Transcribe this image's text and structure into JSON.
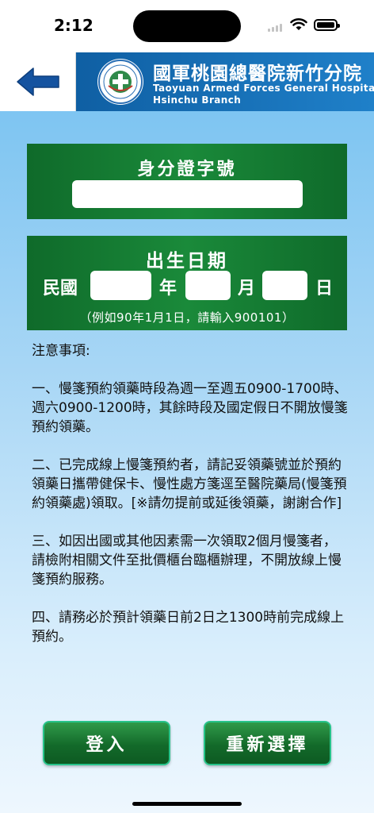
{
  "status_bar": {
    "time": "2:12"
  },
  "header": {
    "back_icon": "arrow-left-icon",
    "hospital_name_zh": "國軍桃園總醫院新竹分院",
    "hospital_name_en_line1": "Taoyuan Armed Forces General Hospital",
    "hospital_name_en_line2": "Hsinchu Branch",
    "colors": {
      "banner": "#1a73bf",
      "arrow": "#1553a0"
    }
  },
  "id_section": {
    "title": "身分證字號",
    "id_value": ""
  },
  "dob_section": {
    "title": "出生日期",
    "era_label": "民國",
    "year_label": "年",
    "month_label": "月",
    "day_label": "日",
    "year_value": "",
    "month_value": "",
    "day_value": "",
    "hint": "（例如90年1月1日，請輸入900101）"
  },
  "notes": {
    "heading": "注意事項:",
    "items": [
      "一、慢箋預約領藥時段為週一至週五0900-1700時、週六0900-1200時，其餘時段及國定假日不開放慢箋預約領藥。",
      "二、已完成線上慢箋預約者，請記妥領藥號並於預約領藥日攜帶健保卡、慢性處方箋逕至醫院藥局(慢箋預約領藥處)領取。[※請勿提前或延後領藥，謝謝合作]",
      "三、如因出國或其他因素需一次領取2個月慢箋者，請檢附相關文件至批價櫃台臨櫃辦理，不開放線上慢箋預約服務。",
      "四、請務必於預計領藥日前2日之1300時前完成線上預約。"
    ]
  },
  "buttons": {
    "login": "登入",
    "reset": "重新選擇",
    "color": "#136a2a"
  }
}
